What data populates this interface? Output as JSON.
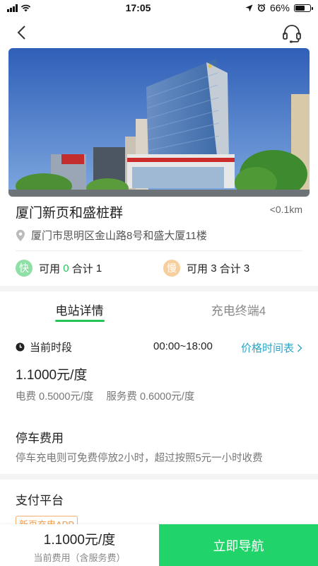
{
  "status_bar": {
    "time": "17:05",
    "battery_percent": "66%",
    "battery_level": 0.66
  },
  "station": {
    "name": "厦门新页和盛桩群",
    "distance": "<0.1km",
    "address": "厦门市思明区金山路8号和盛大厦11楼",
    "fast": {
      "badge": "快",
      "available_label": "可用",
      "available_count": "0",
      "total_label": "合计",
      "total_count": "1"
    },
    "slow": {
      "badge": "慢",
      "available_label": "可用",
      "available_count": "3",
      "total_label": "合计",
      "total_count": "3"
    }
  },
  "tabs": [
    {
      "label": "电站详情",
      "active": true
    },
    {
      "label": "充电终端4",
      "active": false
    }
  ],
  "pricing": {
    "current_period_label": "当前时段",
    "current_period_time": "00:00~18:00",
    "price_table_link": "价格时间表",
    "unit_price": "1.1000元/度",
    "electricity_fee": "电费 0.5000元/度",
    "service_fee": "服务费 0.6000元/度"
  },
  "parking": {
    "title": "停车费用",
    "description": "停车充电则可免费停放2小时，超过按照5元一小时收费"
  },
  "payment": {
    "title": "支付平台",
    "tag": "新页充电APP"
  },
  "bottom": {
    "price": "1.1000元/度",
    "price_label": "当前费用（含服务费）",
    "navigate_button": "立即导航"
  },
  "colors": {
    "accent_green": "#21d46a",
    "link_blue": "#2aa7c9"
  }
}
